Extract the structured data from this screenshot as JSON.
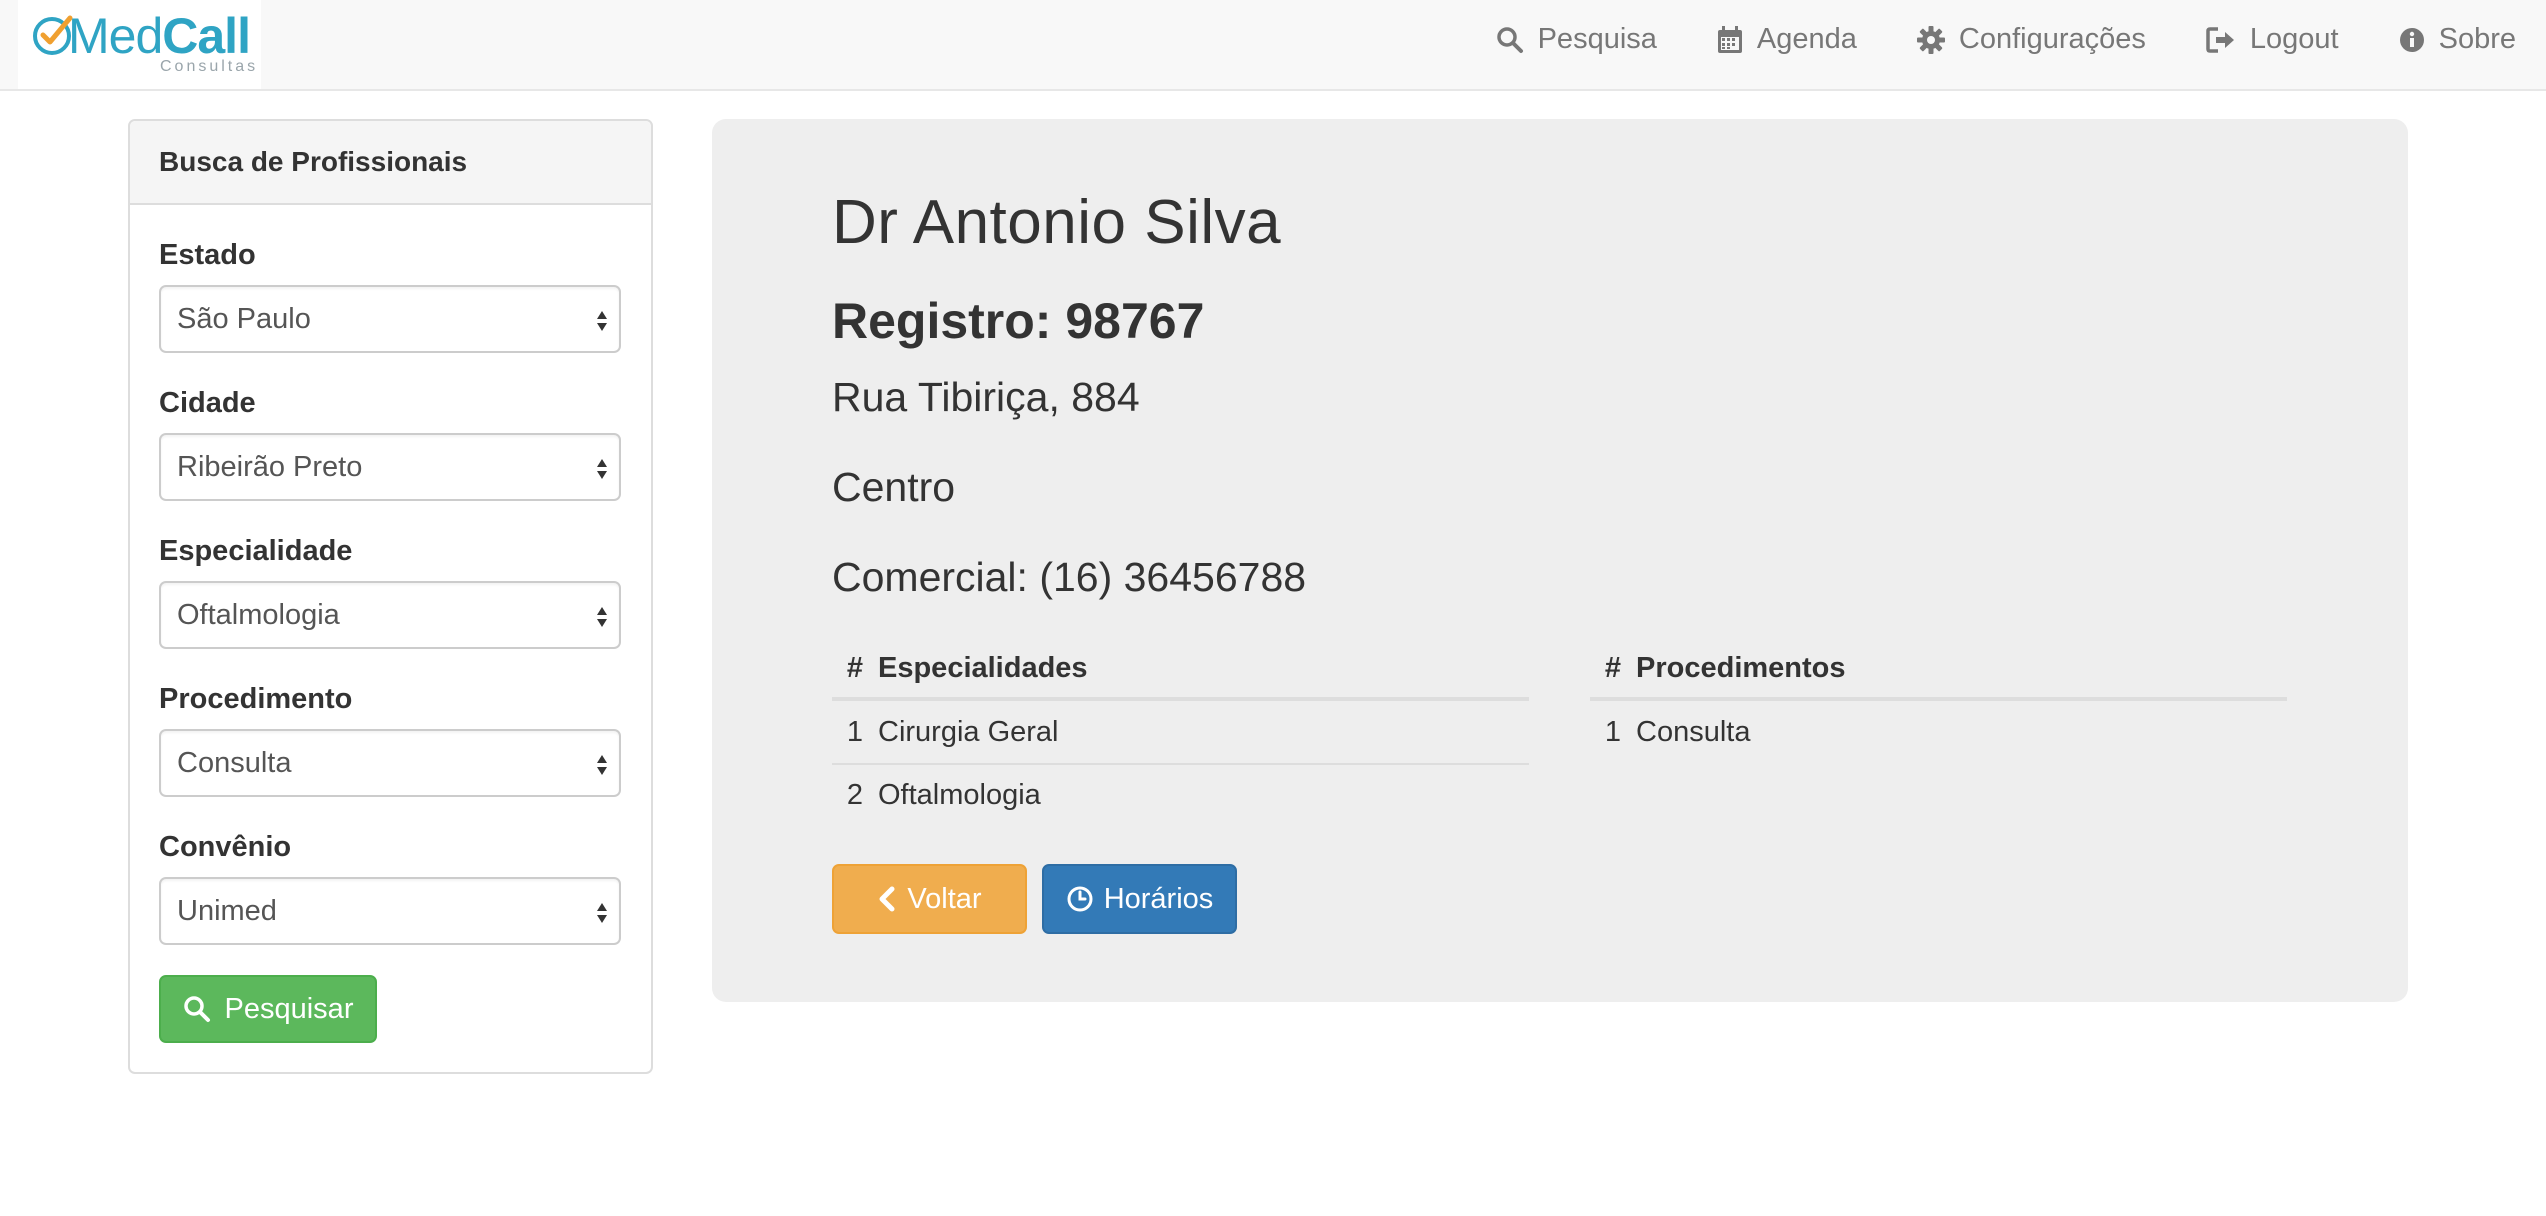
{
  "navbar": {
    "brand": {
      "med": "Med",
      "call": "Call",
      "sub": "Consultas"
    },
    "items": [
      {
        "label": "Pesquisa",
        "icon": "search-icon"
      },
      {
        "label": "Agenda",
        "icon": "calendar-icon"
      },
      {
        "label": "Configurações",
        "icon": "gear-icon"
      },
      {
        "label": "Logout",
        "icon": "logout-icon"
      },
      {
        "label": "Sobre",
        "icon": "info-icon"
      }
    ]
  },
  "search_panel": {
    "title": "Busca de Profissionais",
    "fields": [
      {
        "label": "Estado",
        "value": "São Paulo"
      },
      {
        "label": "Cidade",
        "value": "Ribeirão Preto"
      },
      {
        "label": "Especialidade",
        "value": "Oftalmologia"
      },
      {
        "label": "Procedimento",
        "value": "Consulta"
      },
      {
        "label": "Convênio",
        "value": "Unimed"
      }
    ],
    "search_button": "Pesquisar"
  },
  "professional": {
    "name": "Dr Antonio Silva",
    "registry": "Registro: 98767",
    "address": "Rua Tibiriça, 884",
    "district": "Centro",
    "phone": "Comercial: (16) 36456788",
    "specialties_table": {
      "headers": [
        "#",
        "Especialidades"
      ],
      "rows": [
        [
          "1",
          "Cirurgia Geral"
        ],
        [
          "2",
          "Oftalmologia"
        ]
      ]
    },
    "procedures_table": {
      "headers": [
        "#",
        "Procedimentos"
      ],
      "rows": [
        [
          "1",
          "Consulta"
        ]
      ]
    },
    "back_button": "Voltar",
    "hours_button": "Horários"
  },
  "colors": {
    "brand": "#2fa4c4",
    "success": "#5cb85c",
    "warning": "#f0ad4e",
    "primary": "#337ab7"
  }
}
